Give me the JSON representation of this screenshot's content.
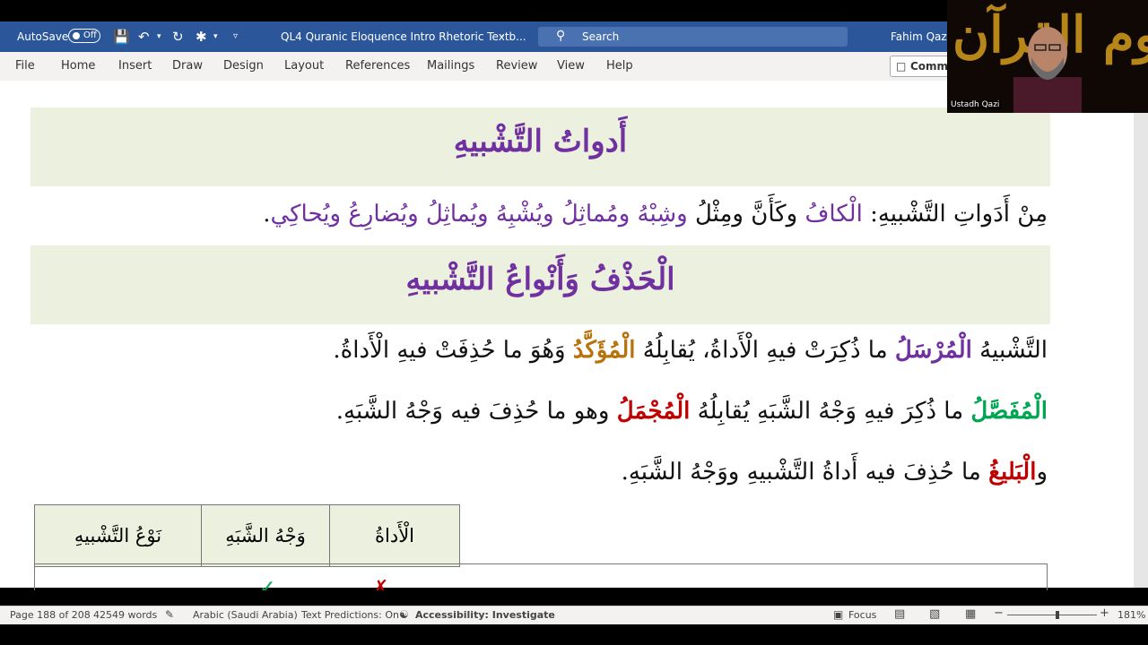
{
  "titlebar": {
    "autosave_label": "AutoSave",
    "autosave_state": "Off",
    "document_title": "QL4 Quranic Eloquence Intro Rhetoric Textb...",
    "search_placeholder": "Search",
    "user_name": "Fahim Qazi"
  },
  "menu": {
    "items": [
      "File",
      "Home",
      "Insert",
      "Draw",
      "Design",
      "Layout",
      "References",
      "Mailings",
      "Review",
      "View",
      "Help"
    ],
    "comments_label": "Comm"
  },
  "document": {
    "heading1": "أَدواتُ التَّشْبيهِ",
    "line1": {
      "prefix": "مِنْ أَدَواتِ التَّشْبيهِ: ",
      "tools": [
        "الْكافُ",
        "وكَأَنَّ",
        "ومِثْلُ",
        "وشِبْهُ",
        "ومُماثِلُ",
        "ويُشْبِهُ",
        "ويُماثِلُ",
        "ويُضارِعُ",
        "ويُحاكِي"
      ],
      "end": "."
    },
    "heading2": "الْحَذْفُ وَأَنْواعُ التَّشْبيهِ",
    "line2": {
      "a": "التَّشْبيهُ ",
      "b": "الْمُرْسَلُ",
      "c": " ما ذُكِرَتْ فيهِ الْأَداةُ، يُقابِلُهُ ",
      "d": "الْمُؤَكَّدُ",
      "e": " وَهُوَ ما حُذِفَتْ فيهِ الْأَداةُ."
    },
    "line3": {
      "a": "الْمُفَصَّلُ",
      "b": " ما ذُكِرَ فيهِ وَجْهُ الشَّبَهِ يُقابِلُهُ ",
      "c": "الْمُجْمَلُ",
      "d": " وهو ما حُذِفَ فيه وَجْهُ الشَّبَهِ."
    },
    "line4": {
      "a": "و",
      "b": "الْبَليغُ",
      "c": " ما حُذِفَ فيه أَداةُ التَّشْبيهِ ووَجْهُ الشَّبَهِ."
    },
    "table": {
      "headers": [
        "الْأَداةُ",
        "وَجْهُ الشَّبَهِ",
        "نَوْعُ التَّشْبيهِ"
      ]
    }
  },
  "statusbar": {
    "page": "Page 188 of 208",
    "words": "42549 words",
    "language": "Arabic (Saudi Arabia)",
    "predictions": "Text Predictions: On",
    "accessibility": "Accessibility: Investigate",
    "focus": "Focus",
    "zoom": "181%"
  },
  "webcam": {
    "label": "Ustadh Qazi",
    "calligraphy": "علوم القرآن"
  },
  "colors": {
    "ribbon_blue": "#2b579a",
    "heading_purple": "#7030a0",
    "band_green": "#ebf1de",
    "term_brown": "#b8720b",
    "term_green": "#00a651",
    "term_red": "#c00000"
  }
}
